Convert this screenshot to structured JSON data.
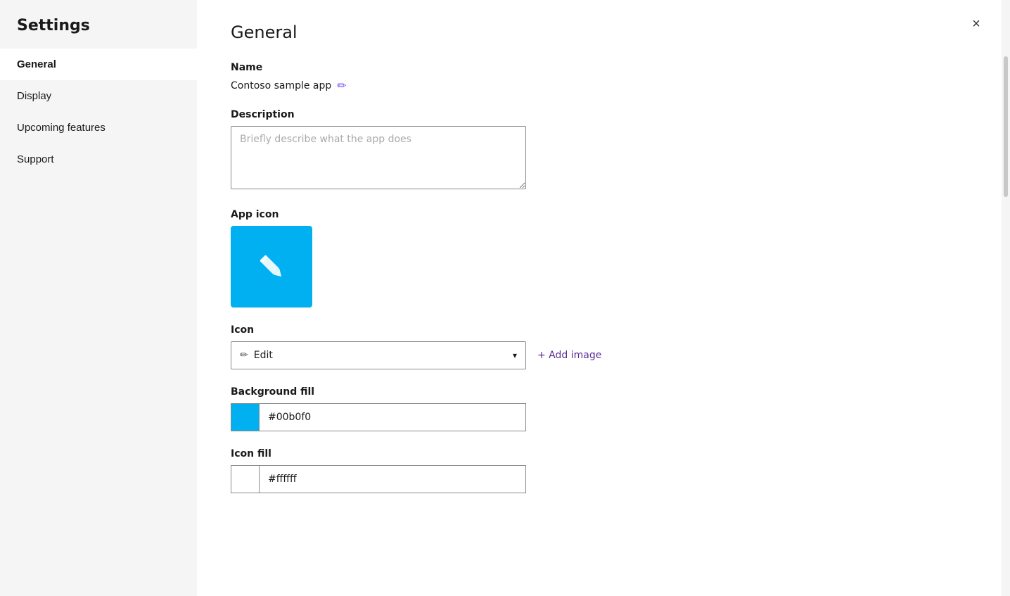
{
  "sidebar": {
    "title": "Settings",
    "items": [
      {
        "id": "general",
        "label": "General",
        "active": true
      },
      {
        "id": "display",
        "label": "Display",
        "active": false
      },
      {
        "id": "upcoming-features",
        "label": "Upcoming features",
        "active": false
      },
      {
        "id": "support",
        "label": "Support",
        "active": false
      }
    ]
  },
  "main": {
    "page_title": "General",
    "sections": {
      "name": {
        "label": "Name",
        "value": "Contoso sample app",
        "edit_tooltip": "Edit"
      },
      "description": {
        "label": "Description",
        "placeholder": "Briefly describe what the app does"
      },
      "app_icon": {
        "label": "App icon",
        "bg_color": "#00b0f0"
      },
      "icon": {
        "label": "Icon",
        "selected": "Edit",
        "add_image_label": "+ Add image"
      },
      "background_fill": {
        "label": "Background fill",
        "color": "#00b0f0",
        "hex_value": "#00b0f0"
      },
      "icon_fill": {
        "label": "Icon fill",
        "color": "#ffffff",
        "hex_value": "#ffffff"
      }
    }
  },
  "close_button_label": "×"
}
